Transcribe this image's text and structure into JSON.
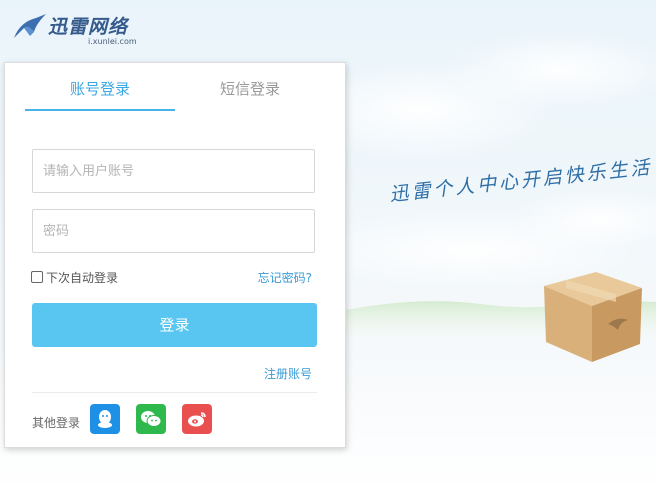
{
  "brand": {
    "name": "迅雷网络",
    "domain": "i.xunlei.com"
  },
  "slogan": "迅雷个人中心开启快乐生活",
  "login": {
    "tabs": [
      {
        "label": "账号登录",
        "active": true
      },
      {
        "label": "短信登录",
        "active": false
      }
    ],
    "username_placeholder": "请输入用户账号",
    "password_placeholder": "密码",
    "remember_label": "下次自动登录",
    "forgot_label": "忘记密码?",
    "submit_label": "登录",
    "register_label": "注册账号",
    "other_login_label": "其他登录",
    "social": [
      {
        "name": "qq-icon",
        "color": "#1e90e6"
      },
      {
        "name": "wechat-icon",
        "color": "#2fb84c"
      },
      {
        "name": "weibo-icon",
        "color": "#ea4f4f"
      }
    ]
  },
  "colors": {
    "accent": "#39a7e3",
    "button": "#59c6f2"
  }
}
